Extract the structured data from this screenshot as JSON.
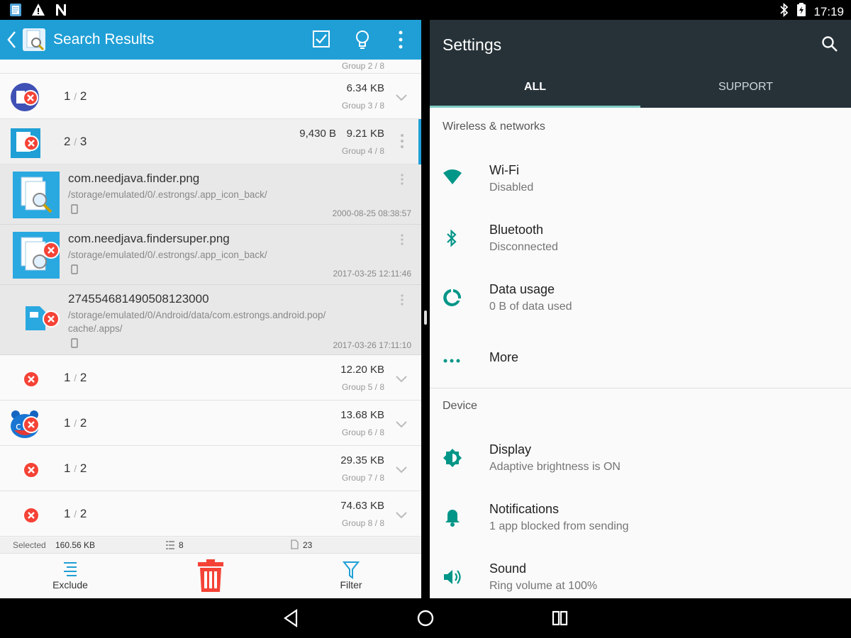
{
  "status_bar": {
    "time": "17:19",
    "left_icons": [
      "notes-icon",
      "warning-icon",
      "n-icon"
    ],
    "right_icons": [
      "bluetooth-icon",
      "battery-icon"
    ]
  },
  "left_app": {
    "title": "Search Results",
    "actions": [
      "select-all-icon",
      "lightbulb-icon",
      "more-vert-icon"
    ],
    "partial_row_label": "Group 2 / 8",
    "groups": [
      {
        "count": "1",
        "total": "2",
        "size": "6.34 KB",
        "size_extra": "",
        "label": "Group 3 / 8"
      },
      {
        "count": "2",
        "total": "3",
        "size": "9.21 KB",
        "size_extra": "9,430 B",
        "label": "Group 4 / 8"
      },
      {
        "count": "1",
        "total": "2",
        "size": "12.20 KB",
        "size_extra": "",
        "label": "Group 5 / 8"
      },
      {
        "count": "1",
        "total": "2",
        "size": "13.68 KB",
        "size_extra": "",
        "label": "Group 6 / 8"
      },
      {
        "count": "1",
        "total": "2",
        "size": "29.35 KB",
        "size_extra": "",
        "label": "Group 7 / 8"
      },
      {
        "count": "1",
        "total": "2",
        "size": "74.63 KB",
        "size_extra": "",
        "label": "Group 8 / 8"
      }
    ],
    "files": [
      {
        "name": "com.needjava.finder.png",
        "path_line1": "/storage/emulated/0/.estrongs/.app_icon_back/",
        "path_line2": "",
        "date": "2000-08-25 08:38:57"
      },
      {
        "name": "com.needjava.findersuper.png",
        "path_line1": "/storage/emulated/0/.estrongs/.app_icon_back/",
        "path_line2": "",
        "date": "2017-03-25 12:11:46"
      },
      {
        "name": "274554681490508123000",
        "path_line1": "/storage/emulated/0/Android/data/com.estrongs.android.pop/",
        "path_line2": "cache/.apps/",
        "date": "2017-03-26 17:11:10"
      }
    ],
    "info": {
      "selected_label": "Selected",
      "selected_size": "160.56 KB",
      "groups_count": "8",
      "files_count": "23"
    },
    "toolbar": {
      "exclude": "Exclude",
      "filter": "Filter"
    },
    "colors": {
      "accent": "#1f9fd6",
      "delete": "#f44336"
    }
  },
  "settings": {
    "title": "Settings",
    "tabs": [
      "ALL",
      "SUPPORT"
    ],
    "sections": [
      {
        "header": "Wireless & networks",
        "items": [
          {
            "icon": "wifi-icon",
            "title": "Wi-Fi",
            "subtitle": "Disabled"
          },
          {
            "icon": "bluetooth-icon",
            "title": "Bluetooth",
            "subtitle": "Disconnected"
          },
          {
            "icon": "data-usage-icon",
            "title": "Data usage",
            "subtitle": "0 B of data used"
          },
          {
            "icon": "more-horiz-icon",
            "title": "More",
            "subtitle": ""
          }
        ]
      },
      {
        "header": "Device",
        "items": [
          {
            "icon": "display-icon",
            "title": "Display",
            "subtitle": "Adaptive brightness is ON"
          },
          {
            "icon": "bell-icon",
            "title": "Notifications",
            "subtitle": "1 app blocked from sending"
          },
          {
            "icon": "volume-icon",
            "title": "Sound",
            "subtitle": "Ring volume at 100%"
          }
        ]
      }
    ],
    "colors": {
      "header": "#263238",
      "accent": "#009688"
    }
  },
  "nav": [
    "back-icon",
    "home-icon",
    "recents-icon"
  ]
}
